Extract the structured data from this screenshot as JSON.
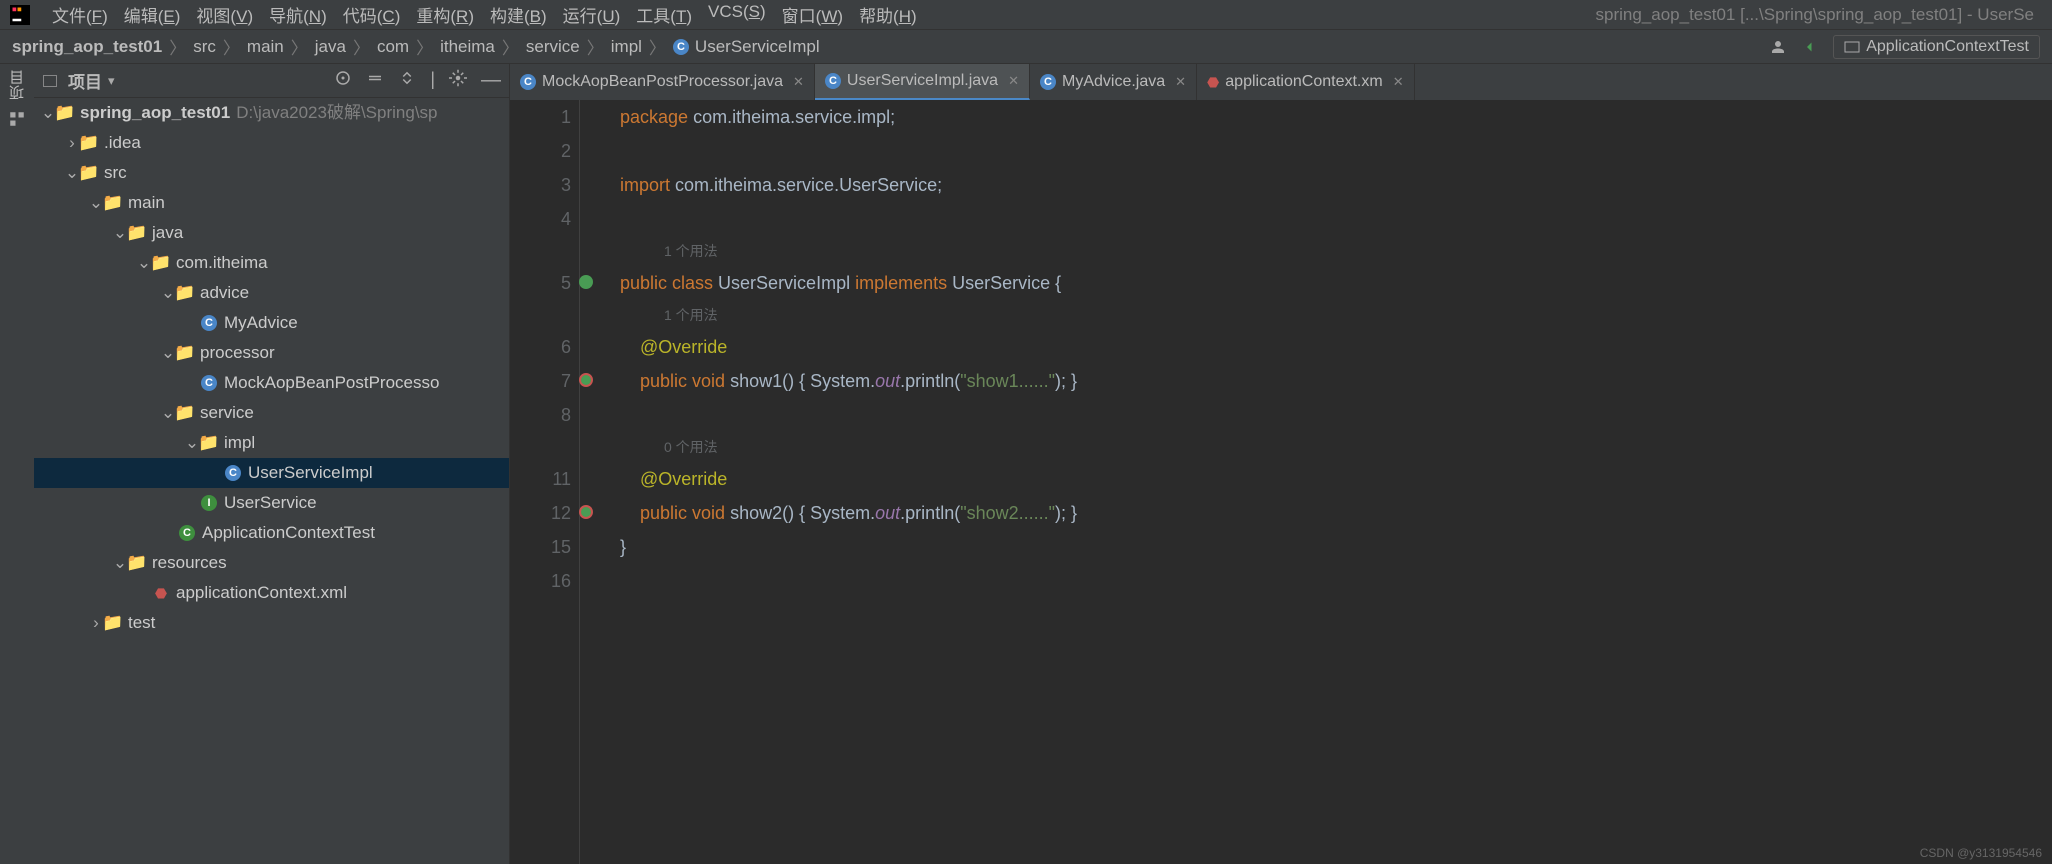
{
  "menu": [
    "文件(F)",
    "编辑(E)",
    "视图(V)",
    "导航(N)",
    "代码(C)",
    "重构(R)",
    "构建(B)",
    "运行(U)",
    "工具(T)",
    "VCS(S)",
    "窗口(W)",
    "帮助(H)"
  ],
  "window_title": "spring_aop_test01 [...\\Spring\\spring_aop_test01] - UserSe",
  "breadcrumb": [
    "spring_aop_test01",
    "src",
    "main",
    "java",
    "com",
    "itheima",
    "service",
    "impl"
  ],
  "breadcrumb_file": "UserServiceImpl",
  "run_config": "ApplicationContextTest",
  "panel_title": "项目",
  "left_strip_label": "项目",
  "tree": {
    "root": "spring_aop_test01",
    "root_path": "D:\\java2023破解\\Spring\\sp",
    "idea": ".idea",
    "src": "src",
    "main": "main",
    "java": "java",
    "pkg": "com.itheima",
    "advice": "advice",
    "myadvice": "MyAdvice",
    "processor": "processor",
    "mock": "MockAopBeanPostProcesso",
    "service": "service",
    "impl": "impl",
    "usi": "UserServiceImpl",
    "us": "UserService",
    "act": "ApplicationContextTest",
    "resources": "resources",
    "appctx": "applicationContext.xml",
    "test": "test"
  },
  "tabs": [
    {
      "label": "MockAopBeanPostProcessor.java",
      "kind": "c"
    },
    {
      "label": "UserServiceImpl.java",
      "kind": "c",
      "active": true
    },
    {
      "label": "MyAdvice.java",
      "kind": "c"
    },
    {
      "label": "applicationContext.xm",
      "kind": "x"
    }
  ],
  "gutter": [
    "1",
    "2",
    "3",
    "4",
    "",
    "5",
    "",
    "6",
    "7",
    "",
    "",
    "8",
    "12",
    "15",
    "16"
  ],
  "code": {
    "l1_kw": "package",
    "l1_rest": " com.itheima.service.impl;",
    "l3_kw": "import",
    "l3_rest": " com.itheima.service.UserService;",
    "hint1": "1 个用法",
    "l5a": "public ",
    "l5b": "class ",
    "l5c": "UserServiceImpl ",
    "l5d": "implements ",
    "l5e": "UserService {",
    "hint2": "1 个用法",
    "ann": "@Override",
    "l7a": "public ",
    "l7b": "void ",
    "l7c": "show1() ",
    "l7d": "{ System.",
    "l7e": "out",
    "l7f": ".println(",
    "l7g": "\"show1......\"",
    "l7h": "); }",
    "hint3": "0 个用法",
    "l12a": "public ",
    "l12b": "void ",
    "l12c": "show2() ",
    "l12d": "{ System.",
    "l12e": "out",
    "l12f": ".println(",
    "l12g": "\"show2......\"",
    "l12h": "); }",
    "close": "}"
  },
  "watermark": "CSDN @y3131954546"
}
